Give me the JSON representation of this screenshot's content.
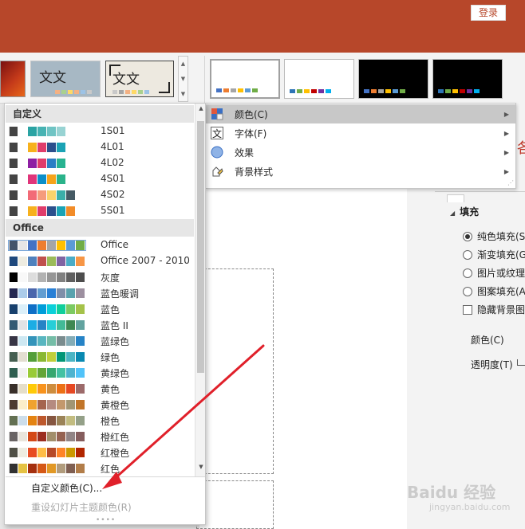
{
  "titlebar": {
    "login_label": "登录",
    "color": "#b7472a"
  },
  "ribbon": {
    "theme_glyph": "文文",
    "theme2_text": "文文",
    "theme3_text": "文文",
    "theme_scroll_icons": [
      "chevron-up-icon",
      "chevron-down-icon",
      "more-icon"
    ],
    "variants": [
      {
        "bg": "#ffffff",
        "colors": [
          "#4472c4",
          "#ed7d31",
          "#a5a5a5",
          "#ffc000",
          "#5b9bd5",
          "#70ad47"
        ],
        "selected": true
      },
      {
        "bg": "#ffffff",
        "colors": [
          "#2e75b6",
          "#70ad47",
          "#ffc000",
          "#c00000",
          "#7030a0",
          "#00b0f0"
        ],
        "selected": false
      },
      {
        "bg": "#000000",
        "colors": [
          "#4472c4",
          "#ed7d31",
          "#a5a5a5",
          "#ffc000",
          "#5b9bd5",
          "#70ad47"
        ],
        "selected": false
      },
      {
        "bg": "#000000",
        "colors": [
          "#2e75b6",
          "#70ad47",
          "#ffc000",
          "#c00000",
          "#7030a0",
          "#00b0f0"
        ],
        "selected": false
      }
    ]
  },
  "submenu": {
    "items": [
      {
        "label": "颜色(C)",
        "icon": "color-palette-icon",
        "active": true
      },
      {
        "label": "字体(F)",
        "icon": "font-icon",
        "active": false
      },
      {
        "label": "效果",
        "icon": "effects-icon",
        "active": false
      },
      {
        "label": "背景样式",
        "icon": "background-style-icon",
        "active": false
      }
    ],
    "grip": "⋰"
  },
  "dropdown": {
    "custom_header": "自定义",
    "custom_rows": [
      {
        "name": "1S01",
        "colors": [
          "#444444",
          "#ffffff",
          "#2aa3a3",
          "#47b3b3",
          "#6fc4c4",
          "#98d3d3",
          "#ffffff",
          "#ffffff"
        ]
      },
      {
        "name": "4L01",
        "colors": [
          "#444444",
          "#ffffff",
          "#f7b11d",
          "#e03c6b",
          "#2b4f8c",
          "#1ba3b5",
          "#ffffff",
          "#ffffff"
        ]
      },
      {
        "name": "4L02",
        "colors": [
          "#444444",
          "#ffffff",
          "#8e1fa3",
          "#e03c6b",
          "#2b7fc4",
          "#28b391",
          "#ffffff",
          "#ffffff"
        ]
      },
      {
        "name": "4S01",
        "colors": [
          "#444444",
          "#ffffff",
          "#e0357a",
          "#0b8fc9",
          "#f6a31a",
          "#2bb38a",
          "#ffffff",
          "#ffffff"
        ]
      },
      {
        "name": "4S02",
        "colors": [
          "#444444",
          "#ffffff",
          "#f26b77",
          "#f59c7c",
          "#f9d36b",
          "#3aafa9",
          "#455a64",
          "#ffffff"
        ]
      },
      {
        "name": "5S01",
        "colors": [
          "#444444",
          "#ffffff",
          "#f7b11d",
          "#e03c6b",
          "#2b4f8c",
          "#1ba3b5",
          "#f28c28",
          "#ffffff"
        ]
      }
    ],
    "office_header": "Office",
    "office_rows": [
      {
        "name": "Office",
        "colors": [
          "#44546a",
          "#e7e6e6",
          "#4472c4",
          "#ed7d31",
          "#a5a5a5",
          "#ffc000",
          "#5b9bd5",
          "#70ad47"
        ],
        "highlight": true
      },
      {
        "name": "Office 2007 - 2010",
        "colors": [
          "#1f497d",
          "#eeece1",
          "#4f81bd",
          "#c0504d",
          "#9bbb59",
          "#8064a2",
          "#4bacc6",
          "#f79646"
        ]
      },
      {
        "name": "灰度",
        "colors": [
          "#000000",
          "#f8f8f8",
          "#dddddd",
          "#b2b2b2",
          "#969696",
          "#808080",
          "#5f5f5f",
          "#4d4d4d"
        ]
      },
      {
        "name": "蓝色暖调",
        "colors": [
          "#242852",
          "#acccea",
          "#4a66ac",
          "#629dd1",
          "#297fd5",
          "#7f8fa9",
          "#5aa2ae",
          "#9d90a0"
        ]
      },
      {
        "name": "蓝色",
        "colors": [
          "#17406d",
          "#dbeff9",
          "#0f6fc6",
          "#009dd9",
          "#0bd0d9",
          "#10cf9b",
          "#7cca62",
          "#a5c249"
        ]
      },
      {
        "name": "蓝色 II",
        "colors": [
          "#335b74",
          "#dfe3e5",
          "#1cade4",
          "#2683c6",
          "#27ced7",
          "#42ba97",
          "#3e8853",
          "#62a39f"
        ]
      },
      {
        "name": "蓝绿色",
        "colors": [
          "#373545",
          "#cee8f2",
          "#3494ba",
          "#58b6c0",
          "#75bda7",
          "#7a8c8e",
          "#84acb6",
          "#2683c6"
        ]
      },
      {
        "name": "绿色",
        "colors": [
          "#455f51",
          "#e3ded1",
          "#549e39",
          "#8ab833",
          "#c0cf3a",
          "#029676",
          "#4ab5c4",
          "#0989b1"
        ]
      },
      {
        "name": "黄绿色",
        "colors": [
          "#2f5f51",
          "#f2f2f2",
          "#99cb38",
          "#63a537",
          "#37a76f",
          "#44c1a3",
          "#4eb3cf",
          "#51c3f9"
        ]
      },
      {
        "name": "黄色",
        "colors": [
          "#39302a",
          "#e5dec9",
          "#ffca08",
          "#f8931d",
          "#ce8d3e",
          "#ec7016",
          "#e64823",
          "#9c6a6a"
        ]
      },
      {
        "name": "黄橙色",
        "colors": [
          "#4e3b30",
          "#fbeec9",
          "#f0a22e",
          "#a5644e",
          "#b58b80",
          "#c3986d",
          "#a19574",
          "#c17529"
        ]
      },
      {
        "name": "橙色",
        "colors": [
          "#637052",
          "#ccddea",
          "#e48312",
          "#bd582c",
          "#865640",
          "#9b8357",
          "#c2bc80",
          "#94a088"
        ]
      },
      {
        "name": "橙红色",
        "colors": [
          "#696464",
          "#e9e5dc",
          "#d34817",
          "#9b2d1f",
          "#a28e6a",
          "#956251",
          "#918485",
          "#855d5d"
        ]
      },
      {
        "name": "红橙色",
        "colors": [
          "#505046",
          "#eeece1",
          "#e84c22",
          "#ffbd47",
          "#b64926",
          "#ff8427",
          "#cc9900",
          "#b22600"
        ]
      },
      {
        "name": "红色",
        "colors": [
          "#323232",
          "#e5c243",
          "#a5300f",
          "#d55816",
          "#e19825",
          "#b19c7d",
          "#7f5f52",
          "#b27d49"
        ]
      }
    ],
    "footer": {
      "custom_colors": "自定义颜色(C)...",
      "reset_colors": "重设幻灯片主题颜色(R)",
      "grip": "••••"
    }
  },
  "format_pane": {
    "partial_title": "各",
    "fill_header": "填充",
    "options": [
      {
        "label": "纯色填充(S",
        "type": "radio",
        "checked": true
      },
      {
        "label": "渐变填充(G",
        "type": "radio",
        "checked": false
      },
      {
        "label": "图片或纹理",
        "type": "radio",
        "checked": false
      },
      {
        "label": "图案填充(A",
        "type": "radio",
        "checked": false
      },
      {
        "label": "隐藏背景图",
        "type": "checkbox",
        "checked": false
      }
    ],
    "color_label": "颜色(C)",
    "transparency_label": "透明度(T)"
  },
  "watermark": {
    "text": "Baidu 经验",
    "url": "jingyan.baidu.com"
  },
  "annotation_color": "#e0202a"
}
